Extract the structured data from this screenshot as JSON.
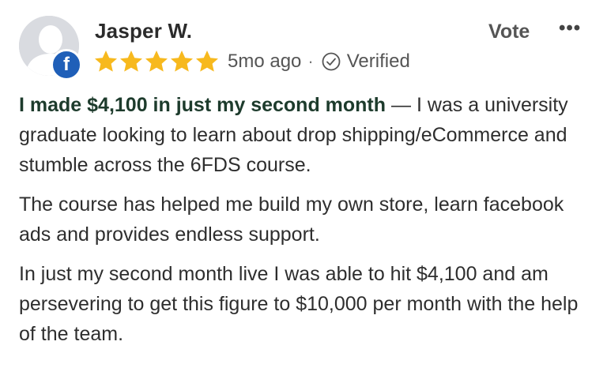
{
  "review": {
    "author": "Jasper W.",
    "vote_label": "Vote",
    "more_label": "•••",
    "social_badge": "f",
    "rating": 5,
    "rating_max": 5,
    "time_ago": "5mo ago",
    "separator": "·",
    "verified_label": "Verified",
    "headline": "I made $4,100 in just my second month",
    "headline_dash": " — ",
    "paragraph_1_rest": "I was a university graduate looking to learn about drop shipping/eCommerce and stumble across the 6FDS course.",
    "paragraph_2": "The course has helped me build my own store, learn facebook ads and provides endless support.",
    "paragraph_3": "In just my second month live I was able to hit $4,100 and am persevering to get this figure to $10,000 per month with the help of the team."
  },
  "icons": {
    "star": "star-icon",
    "verified": "check-circle-icon",
    "badge": "facebook-icon",
    "avatar": "default-avatar-icon"
  },
  "colors": {
    "star": "#f7b91e",
    "facebook_badge": "#1f5fb8",
    "headline": "#1d3b2c",
    "avatar_bg": "#d9dbe0"
  }
}
